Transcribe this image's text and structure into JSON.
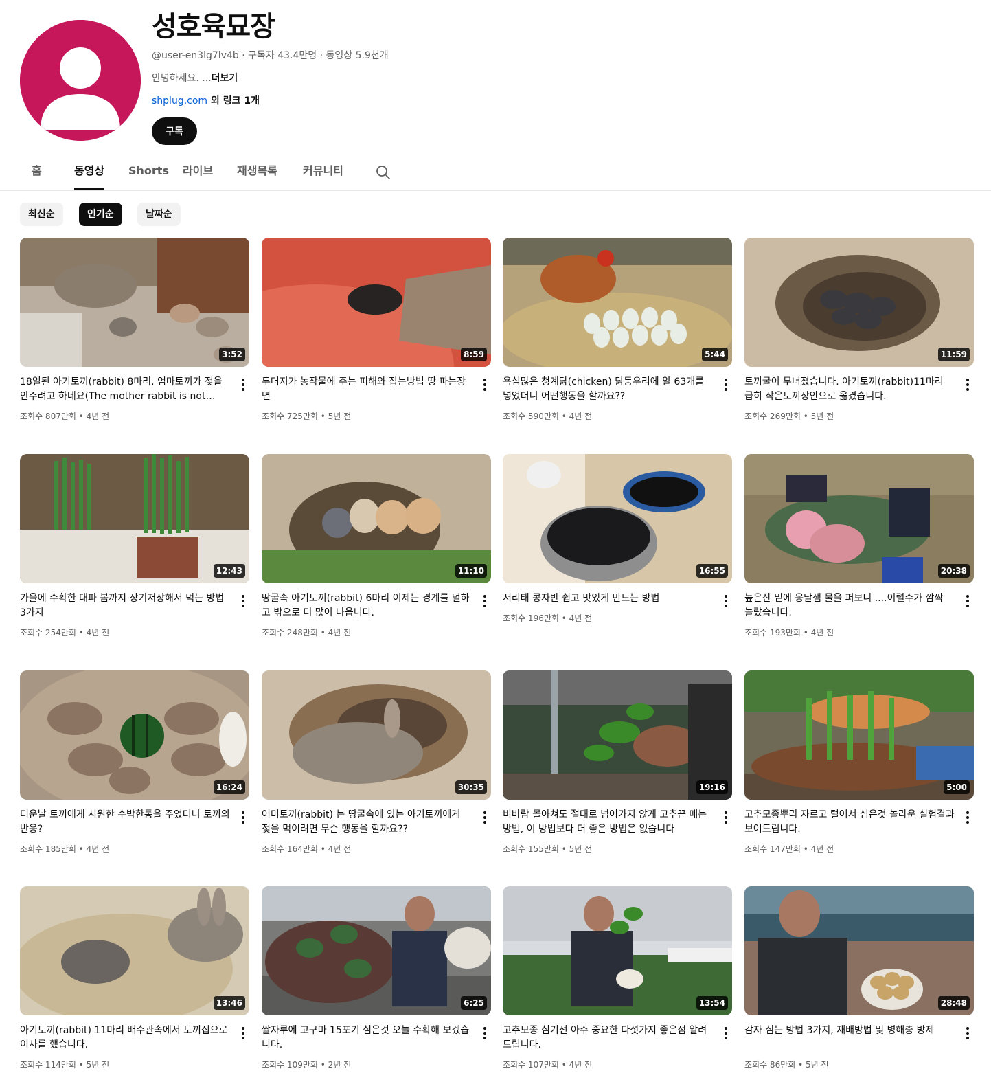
{
  "channel": {
    "name": "성호육묘장",
    "handle": "@user-en3lg7lv4b",
    "subscribers": "구독자 43.4만명",
    "videos": "동영상 5.9천개",
    "separator": " · ",
    "description": "안녕하세요. ...",
    "more_label": "더보기",
    "link_text": "shplug.com",
    "link_extra": " 외 링크 1개",
    "subscribe_label": "구독",
    "avatar_color": "#c5175a"
  },
  "tabs": [
    {
      "label": "홈"
    },
    {
      "label": "동영상",
      "active": true
    },
    {
      "label": "Shorts"
    },
    {
      "label": "라이브"
    },
    {
      "label": "재생목록"
    },
    {
      "label": "커뮤니티"
    }
  ],
  "chips": [
    {
      "label": "최신순"
    },
    {
      "label": "인기순",
      "active": true
    },
    {
      "label": "날짜순"
    }
  ],
  "videos": [
    {
      "title": "18일된 아기토끼(rabbit) 8마리. 엄마토끼가 젖을 안주려고 하네요(The mother rabbit is not breastfeeding)",
      "views": "조회수 807만회",
      "age": "4년 전",
      "duration": "3:52",
      "theme": "rabbits-pen"
    },
    {
      "title": "두더지가 농작물에 주는 피해와 잡는방법 땅 파는장면",
      "views": "조회수 725만회",
      "age": "5년 전",
      "duration": "8:59",
      "theme": "mole-basin"
    },
    {
      "title": "욕심많은 청계닭(chicken) 닭둥우리에 알 63개를 넣었더니 어떤행동을 할까요??",
      "views": "조회수 590만회",
      "age": "4년 전",
      "duration": "5:44",
      "theme": "hen-eggs"
    },
    {
      "title": "토끼굴이 무너졌습니다. 아기토끼(rabbit)11마리 급히 작은토끼장안으로 옮겼습니다.",
      "views": "조회수 269만회",
      "age": "5년 전",
      "duration": "11:59",
      "theme": "burrow"
    },
    {
      "title": "가을에 수확한 대파 봄까지 장기저장해서 먹는 방법 3가지",
      "views": "조회수 254만회",
      "age": "4년 전",
      "duration": "12:43",
      "theme": "green-onion"
    },
    {
      "title": "땅굴속 아기토끼(rabbit) 6마리 이제는 경계를 덜하고 밖으로 더 많이 나옵니다.",
      "views": "조회수 248만회",
      "age": "4년 전",
      "duration": "11:10",
      "theme": "baby-rabbits"
    },
    {
      "title": "서리태 콩자반 쉽고 맛있게 만드는 방법",
      "views": "조회수 196만회",
      "age": "4년 전",
      "duration": "16:55",
      "theme": "beans"
    },
    {
      "title": "높은산 밑에 옹달샘 물을 퍼보니 ....이럴수가 깜짝 놀랐습니다.",
      "views": "조회수 193만회",
      "age": "4년 전",
      "duration": "20:38",
      "theme": "spring"
    },
    {
      "title": "더운날 토끼에게 시원한 수박한통을 주었더니 토끼의 반응?",
      "views": "조회수 185만회",
      "age": "4년 전",
      "duration": "16:24",
      "theme": "watermelon"
    },
    {
      "title": "어미토끼(rabbit) 는 땅굴속에 있는 아기토끼에게 젖을 먹이려면 무슨 행동을 할까요??",
      "views": "조회수 164만회",
      "age": "4년 전",
      "duration": "30:35",
      "theme": "mother-rabbit"
    },
    {
      "title": "비바람 몰아쳐도 절대로 넘어가지 않게 고추끈 매는 방법, 이 방법보다 더 좋은 방법은 없습니다",
      "views": "조회수 155만회",
      "age": "5년 전",
      "duration": "19:16",
      "theme": "pepper-tie"
    },
    {
      "title": "고추모종뿌리 자르고 털어서 심은것 놀라운 실험결과 보여드립니다.",
      "views": "조회수 147만회",
      "age": "4년 전",
      "duration": "5:00",
      "theme": "pepper-roots"
    },
    {
      "title": "아기토끼(rabbit) 11마리 배수관속에서 토끼집으로 이사를 했습니다.",
      "views": "조회수 114만회",
      "age": "5년 전",
      "duration": "13:46",
      "theme": "nest"
    },
    {
      "title": "쌀자루에 고구마 15포기 심은것 오늘 수확해 보겠습니다.",
      "views": "조회수 109만회",
      "age": "2년 전",
      "duration": "6:25",
      "theme": "sweet-potato"
    },
    {
      "title": "고추모종 심기전 아주 중요한 다섯가지 좋은점 알려드립니다.",
      "views": "조회수 107만회",
      "age": "4년 전",
      "duration": "13:54",
      "theme": "greenhouse"
    },
    {
      "title": "감자 심는 방법 3가지, 재배방법 및 병해충 방제",
      "views": "조회수 86만회",
      "age": "5년 전",
      "duration": "28:48",
      "theme": "potato"
    }
  ]
}
